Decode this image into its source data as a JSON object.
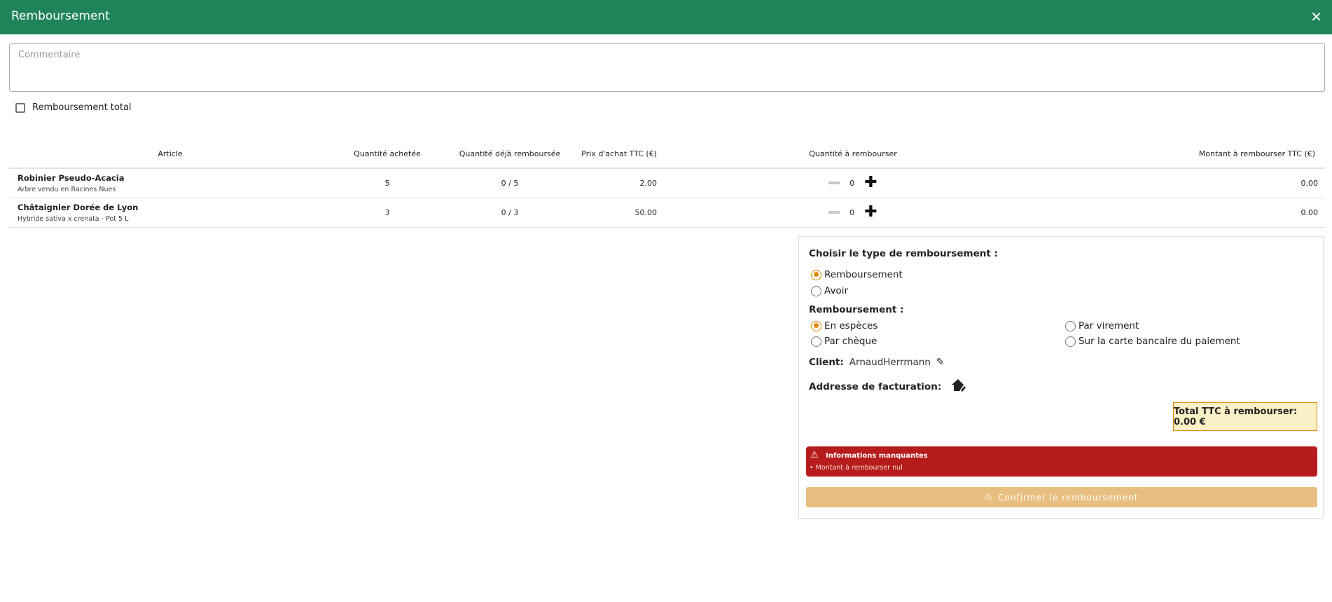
{
  "header": {
    "title": "Remboursement",
    "close": "✕"
  },
  "comment": {
    "placeholder": "Commentaire",
    "value": ""
  },
  "full_refund": {
    "label": "Remboursement total",
    "checked": false
  },
  "table": {
    "headers": [
      "Article",
      "Quantité achetée",
      "Quantité déjà remboursée",
      "Prix d'achat TTC (€)",
      "Quantité à rembourser",
      "Montant à rembourser TTC (€)"
    ],
    "rows": [
      {
        "name": "Robinier Pseudo-Acacia",
        "sub": "Arbre vendu en Racines Nues",
        "qty": "5",
        "refunded": "0 / 5",
        "price": "2.00",
        "to_refund": "0",
        "amount": "0.00"
      },
      {
        "name": "Châtaignier Dorée de Lyon",
        "sub": "Hybride sativa x crenata - Pot 5 L",
        "qty": "3",
        "refunded": "0 / 3",
        "price": "50.00",
        "to_refund": "0",
        "amount": "0.00"
      }
    ]
  },
  "panel": {
    "type_label": "Choisir le type de remboursement :",
    "types": [
      "Remboursement",
      "Avoir"
    ],
    "method_label": "Remboursement :",
    "methods": [
      "En espèces",
      "Par virement",
      "Par chèque",
      "Sur la carte bancaire du paiement"
    ],
    "client_label": "Client:",
    "client": "ArnaudHerrmann",
    "address_label": "Addresse de facturation:",
    "total": "Total TTC à rembourser: 0.00 €",
    "alert_title": "Informations manquantes",
    "alert_msg": "• Montant à rembourser nul",
    "confirm": "Confirmer le remboursement",
    "accent": "#e08a00"
  }
}
